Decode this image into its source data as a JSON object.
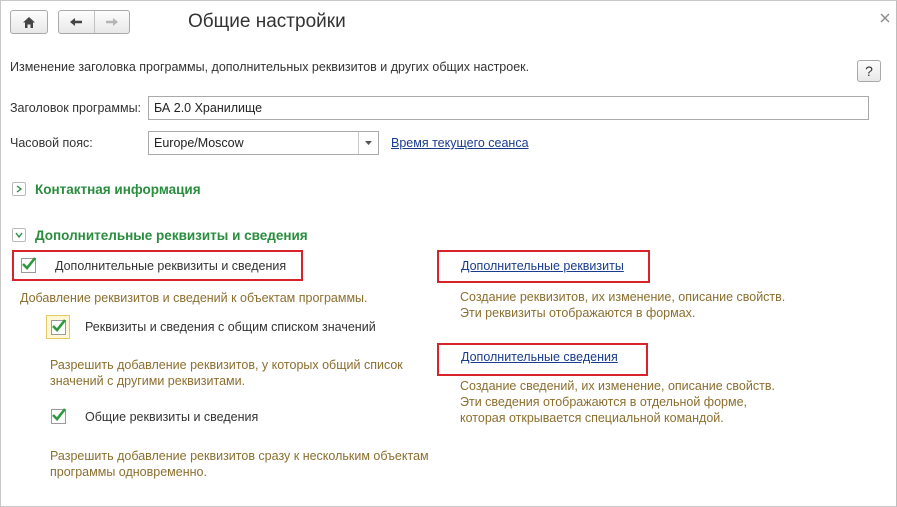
{
  "header": {
    "title": "Общие настройки",
    "home_icon": "home-icon",
    "back_icon": "arrow-left-icon",
    "forward_icon": "arrow-right-icon",
    "close_icon": "close-icon"
  },
  "intro": "Изменение заголовка программы, дополнительных реквизитов и других общих настроек.",
  "help_label": "?",
  "form": {
    "title_label": "Заголовок программы:",
    "title_value": "БА 2.0 Хранилище",
    "timezone_label": "Часовой пояс:",
    "timezone_value": "Europe/Moscow",
    "session_time_link": "Время текущего сеанса"
  },
  "sections": {
    "contact": {
      "title": "Контактная информация",
      "expanded": false
    },
    "additional": {
      "title": "Дополнительные реквизиты и сведения",
      "expanded": true
    }
  },
  "options": {
    "main": {
      "label": "Дополнительные реквизиты и сведения",
      "checked": true,
      "desc": "Добавление реквизитов и сведений к объектам программы."
    },
    "shared_list": {
      "label": "Реквизиты и сведения с общим списком значений",
      "checked": true,
      "desc1": "Разрешить добавление реквизитов, у которых общий список",
      "desc2": "значений с другими реквизитами."
    },
    "common": {
      "label": "Общие реквизиты и сведения",
      "checked": true,
      "desc1": "Разрешить добавление реквизитов сразу к нескольким объектам",
      "desc2": "программы одновременно."
    }
  },
  "links": {
    "props": {
      "label": "Дополнительные реквизиты",
      "desc1": "Создание реквизитов, их изменение, описание свойств.",
      "desc2": "Эти реквизиты отображаются в формах."
    },
    "info": {
      "label": "Дополнительные сведения",
      "desc1": "Создание сведений, их изменение, описание свойств.",
      "desc2": "Эти сведения отображаются в отдельной форме,",
      "desc3": "которая открывается специальной командой."
    }
  },
  "colors": {
    "section_green": "#2a8d3e",
    "check_green": "#2e9a3e",
    "highlight_red": "#d9232b",
    "desc_brown": "#8b6f2f",
    "link_blue": "#1a3c8f"
  }
}
